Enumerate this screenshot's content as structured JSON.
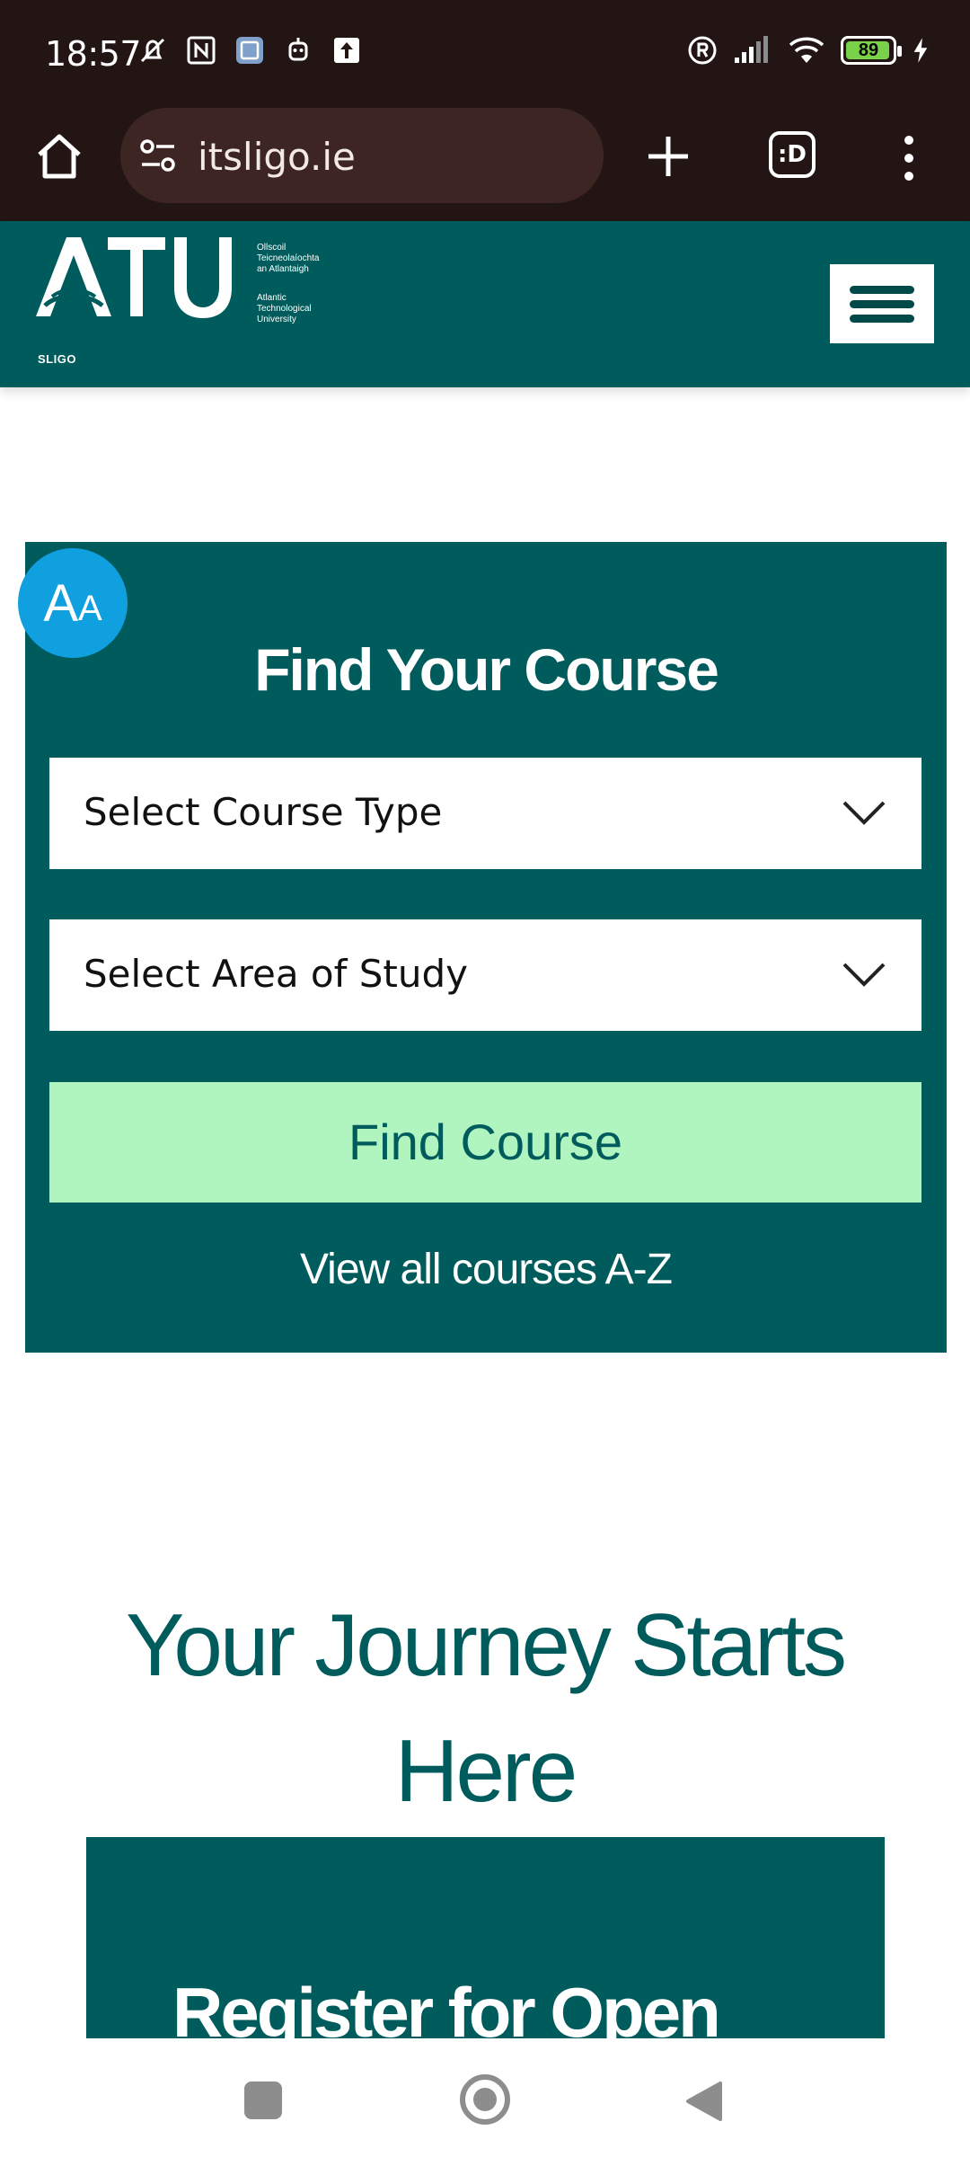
{
  "status_bar": {
    "time": "18:57",
    "battery": "89",
    "left_icons": [
      "mute-icon",
      "nfc-icon",
      "gallery-icon",
      "bot-icon",
      "upload-icon"
    ],
    "right_icons": [
      "registered-icon",
      "signal-icon",
      "wifi-icon",
      "battery-icon",
      "charging-icon"
    ]
  },
  "browser": {
    "url": "itsligo.ie",
    "tabs_label": ":D"
  },
  "site_header": {
    "logo_text": "ATU",
    "logo_irish": "Ollscoil\nTeicneolaíochta\nan Atlantaigh",
    "logo_english": "Atlantic\nTechnological\nUniversity",
    "logo_campus": "SLIGO"
  },
  "accessibility": {
    "big": "A",
    "small": "A"
  },
  "find_course": {
    "title": "Find Your Course",
    "course_type_placeholder": "Select Course Type",
    "area_placeholder": "Select Area of Study",
    "button_label": "Find Course",
    "az_link": "View all courses A-Z"
  },
  "journey": {
    "heading": "Your Journey Starts Here",
    "card_text": "Register for Open"
  },
  "colors": {
    "brand_teal": "#005c5c",
    "find_button": "#b0f5c0",
    "accessibility_blue": "#10a0e0",
    "browser_bar": "#231514"
  }
}
